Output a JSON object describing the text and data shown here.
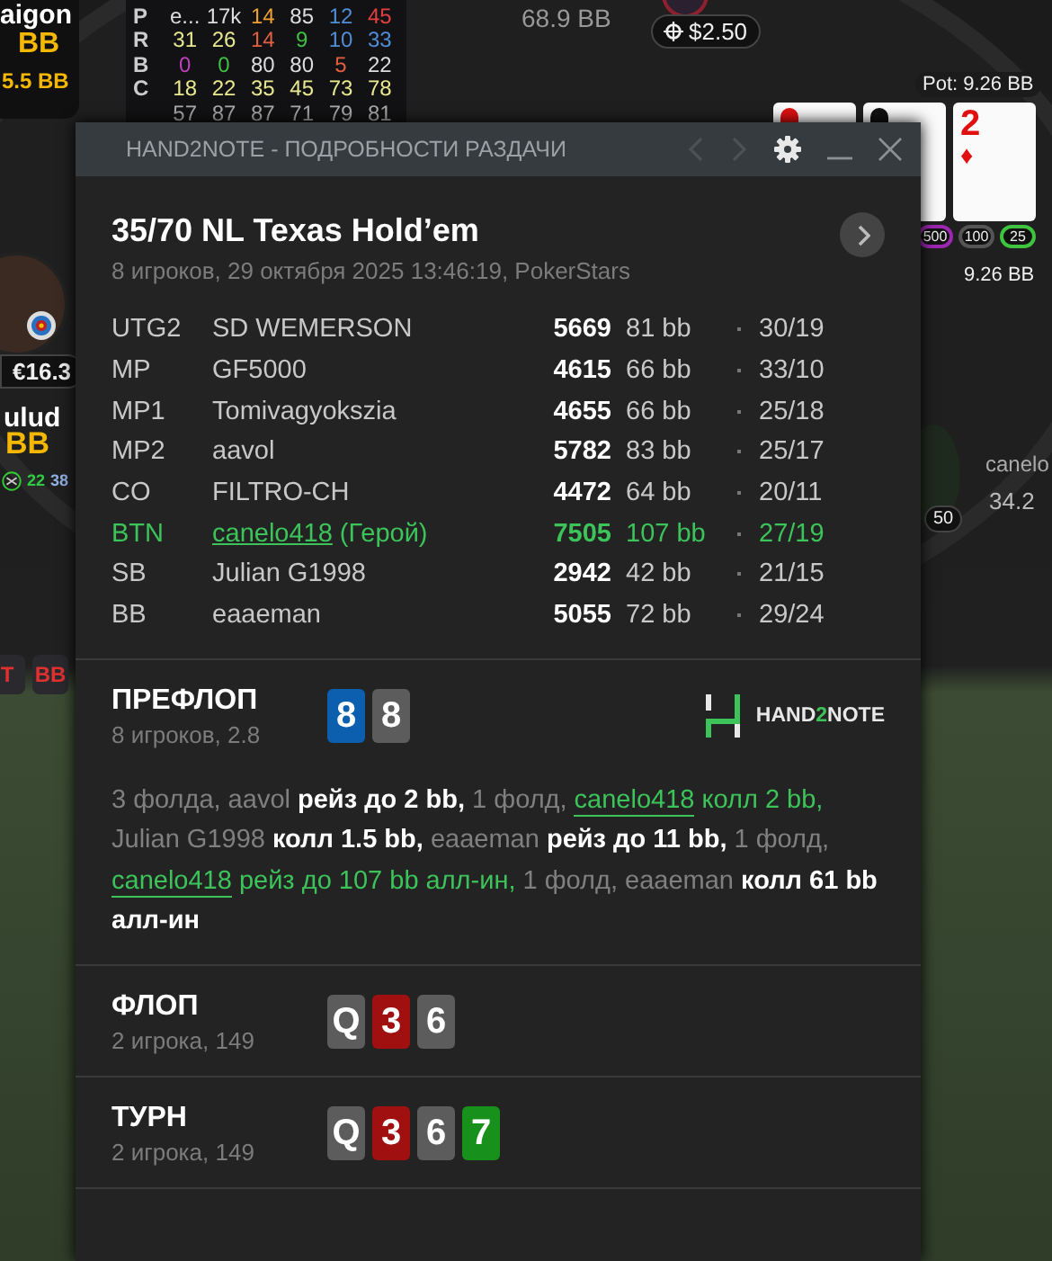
{
  "background": {
    "left_seat_top": {
      "name": "aigon",
      "stack": "BB",
      "bet": "5.5 BB"
    },
    "hud": {
      "row_labels": [
        "P",
        "R",
        "B",
        "C"
      ],
      "rows": [
        [
          {
            "text": "e...",
            "color": "#dddddd"
          },
          {
            "text": "17k",
            "color": "#dddddd"
          },
          {
            "text": "14",
            "color": "#f0a030"
          },
          {
            "text": "85",
            "color": "#dddddd"
          },
          {
            "text": "12",
            "color": "#4f8fd8"
          },
          {
            "text": "45",
            "color": "#e04040"
          }
        ],
        [
          {
            "text": "31",
            "color": "#e8e890"
          },
          {
            "text": "26",
            "color": "#e8e890"
          },
          {
            "text": "14",
            "color": "#e06040"
          },
          {
            "text": "9",
            "color": "#40c040"
          },
          {
            "text": "10",
            "color": "#4f8fd8"
          },
          {
            "text": "33",
            "color": "#4f8fd8"
          }
        ],
        [
          {
            "text": "0",
            "color": "#c040c0"
          },
          {
            "text": "0",
            "color": "#40c040"
          },
          {
            "text": "80",
            "color": "#dddddd"
          },
          {
            "text": "80",
            "color": "#dddddd"
          },
          {
            "text": "5",
            "color": "#e06040"
          },
          {
            "text": "22",
            "color": "#dddddd"
          }
        ],
        [
          {
            "text": "18",
            "color": "#e8e890"
          },
          {
            "text": "22",
            "color": "#e8e890"
          },
          {
            "text": "35",
            "color": "#e8e890"
          },
          {
            "text": "45",
            "color": "#e8e890"
          },
          {
            "text": "73",
            "color": "#e8e890"
          },
          {
            "text": "78",
            "color": "#e8e890"
          }
        ],
        [
          {
            "text": "57",
            "color": "#aaaaaa"
          },
          {
            "text": "87",
            "color": "#aaaaaa"
          },
          {
            "text": "87",
            "color": "#aaaaaa"
          },
          {
            "text": "71",
            "color": "#aaaaaa"
          },
          {
            "text": "79",
            "color": "#aaaaaa"
          },
          {
            "text": "81",
            "color": "#aaaaaa"
          }
        ]
      ]
    },
    "top_seat": {
      "stack": "68.9 BB",
      "bet": "$2.50"
    },
    "pot": "Pot: 9.26 BB",
    "board_cards": [
      {
        "color": "#e01010"
      },
      {
        "color": "#111111"
      },
      {
        "rank": "2",
        "suit_symbol": "♦",
        "color": "#e01010"
      }
    ],
    "chips": [
      {
        "label": "500",
        "color": "#9c27b0"
      },
      {
        "label": "100",
        "color": "#555555"
      },
      {
        "label": "25",
        "color": "#3ec43e"
      }
    ],
    "pot_total": "9.26 BB",
    "left_seat": {
      "stack": "€16.3",
      "name": "ulud",
      "bet": "BB",
      "hud_stats": [
        {
          "text": "22",
          "color": "#2ecc40"
        },
        {
          "text": "38",
          "color": "#8fb0e0"
        }
      ]
    },
    "left_buttons": [
      "T",
      "BB"
    ],
    "right_seat": {
      "name": "canelo",
      "stack": "34.2",
      "bet": "50"
    }
  },
  "window": {
    "title": "HAND2NOTE - ПОДРОБНОСТИ РАЗДАЧИ"
  },
  "hand": {
    "title": "35/70 NL Texas Hold’em",
    "subtitle": "8 игроков, 29 октября 2025 13:46:19, PokerStars"
  },
  "players": [
    {
      "position": "UTG2",
      "name": "SD WEMERSON",
      "stack": "5669",
      "bb": "81 bb",
      "stats": "30/19",
      "hero": false
    },
    {
      "position": "MP",
      "name": "GF5000",
      "stack": "4615",
      "bb": "66 bb",
      "stats": "33/10",
      "hero": false
    },
    {
      "position": "MP1",
      "name": "Tomivagyokszia",
      "stack": "4655",
      "bb": "66 bb",
      "stats": "25/18",
      "hero": false
    },
    {
      "position": "MP2",
      "name": "aavol",
      "stack": "5782",
      "bb": "83 bb",
      "stats": "25/17",
      "hero": false
    },
    {
      "position": "CO",
      "name": "FILTRO-CH",
      "stack": "4472",
      "bb": "64 bb",
      "stats": "20/11",
      "hero": false
    },
    {
      "position": "BTN",
      "name": "canelo418",
      "tag": "(Герой)",
      "stack": "7505",
      "bb": "107 bb",
      "stats": "27/19",
      "hero": true
    },
    {
      "position": "SB",
      "name": "Julian G1998",
      "stack": "2942",
      "bb": "42 bb",
      "stats": "21/15",
      "hero": false
    },
    {
      "position": "BB",
      "name": "eaaeman",
      "stack": "5055",
      "bb": "72 bb",
      "stats": "29/24",
      "hero": false
    }
  ],
  "logo": [
    {
      "text": "HAND",
      "accent": false
    },
    {
      "text": "2",
      "accent": true
    },
    {
      "text": "NOTE",
      "accent": false
    }
  ],
  "streets": [
    {
      "name": "ПРЕФЛОП",
      "subtitle": "8 игроков, 2.8",
      "cards": [
        {
          "rank": "8",
          "color": "#0b5fae"
        },
        {
          "rank": "8",
          "color": "#5c5c5c"
        }
      ],
      "actions": [
        {
          "kind": "muted",
          "text": "3 фолда, aavol "
        },
        {
          "kind": "action",
          "text": "рейз до 2 bb,"
        },
        {
          "kind": "muted",
          "text": " 1 фолд, "
        },
        {
          "kind": "hero_name",
          "text": "canelo418"
        },
        {
          "kind": "hero",
          "text": " колл 2 bb,"
        },
        {
          "kind": "muted",
          "text": " Julian G1998 "
        },
        {
          "kind": "action",
          "text": "колл 1.5 bb,"
        },
        {
          "kind": "muted",
          "text": " eaaeman "
        },
        {
          "kind": "action",
          "text": "рейз до 11 bb,"
        },
        {
          "kind": "muted",
          "text": " 1 фолд, "
        },
        {
          "kind": "hero_name",
          "text": "canelo418"
        },
        {
          "kind": "hero",
          "text": " рейз до 107 bb алл-ин,"
        },
        {
          "kind": "muted",
          "text": " 1 фолд, eaaeman "
        },
        {
          "kind": "action",
          "text": "колл 61 bb алл-ин"
        }
      ]
    },
    {
      "name": "ФЛОП",
      "subtitle": "2 игрока, 149",
      "cards": [
        {
          "rank": "Q",
          "color": "#5c5c5c"
        },
        {
          "rank": "3",
          "color": "#a01010"
        },
        {
          "rank": "6",
          "color": "#5c5c5c"
        }
      ]
    },
    {
      "name": "ТУРН",
      "subtitle": "2 игрока, 149",
      "cards": [
        {
          "rank": "Q",
          "color": "#5c5c5c"
        },
        {
          "rank": "3",
          "color": "#a01010"
        },
        {
          "rank": "6",
          "color": "#5c5c5c"
        },
        {
          "rank": "7",
          "color": "#17901c"
        }
      ]
    }
  ]
}
